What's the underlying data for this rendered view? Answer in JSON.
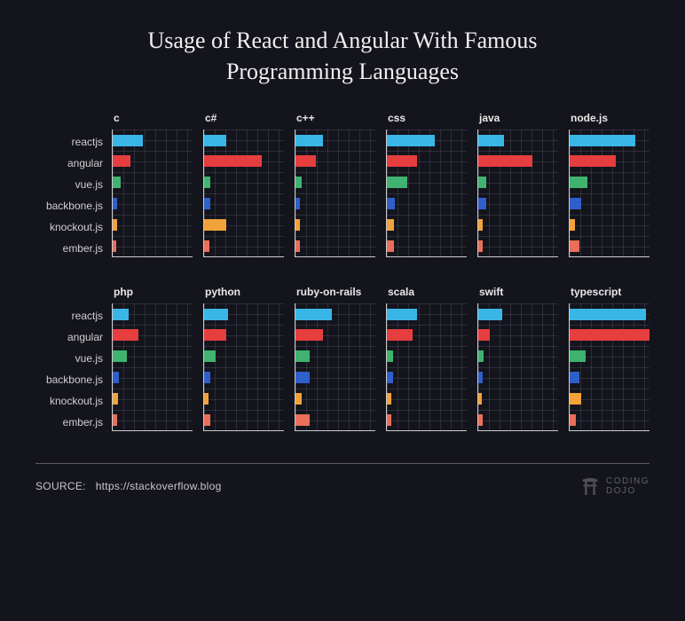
{
  "title_line1": "Usage of React and Angular With Famous",
  "title_line2": "Programming Languages",
  "source_label": "SOURCE:",
  "source_url": "https://stackoverflow.blog",
  "logo_line1": "CODING",
  "logo_line2": "DOJO",
  "frameworks": [
    "reactjs",
    "angular",
    "vue.js",
    "backbone.js",
    "knockout.js",
    "ember.js"
  ],
  "colors": {
    "reactjs": "#3ab6e6",
    "angular": "#e63e3e",
    "vue.js": "#3fb36f",
    "backbone.js": "#2f5fc9",
    "knockout.js": "#f2a23a",
    "ember.js": "#e96f5a"
  },
  "chart_data": {
    "type": "bar",
    "note": "Values are relative bar widths (0-100) estimated from pixel lengths; original axes unlabeled.",
    "series_labels": [
      "reactjs",
      "angular",
      "vue.js",
      "backbone.js",
      "knockout.js",
      "ember.js"
    ],
    "panels": [
      {
        "name": "c",
        "values": [
          38,
          22,
          10,
          6,
          5,
          4
        ]
      },
      {
        "name": "c#",
        "values": [
          28,
          72,
          8,
          8,
          28,
          7
        ]
      },
      {
        "name": "c++",
        "values": [
          34,
          26,
          8,
          6,
          5,
          6
        ]
      },
      {
        "name": "css",
        "values": [
          60,
          38,
          26,
          10,
          9,
          9
        ]
      },
      {
        "name": "java",
        "values": [
          32,
          68,
          10,
          10,
          6,
          5
        ]
      },
      {
        "name": "node.js",
        "values": [
          82,
          58,
          22,
          14,
          7,
          12
        ]
      },
      {
        "name": "php",
        "values": [
          20,
          32,
          18,
          8,
          7,
          6
        ]
      },
      {
        "name": "python",
        "values": [
          30,
          28,
          14,
          8,
          6,
          8
        ]
      },
      {
        "name": "ruby-on-rails",
        "values": [
          46,
          34,
          18,
          18,
          8,
          18
        ]
      },
      {
        "name": "scala",
        "values": [
          38,
          32,
          8,
          8,
          5,
          5
        ]
      },
      {
        "name": "swift",
        "values": [
          30,
          14,
          7,
          6,
          4,
          5
        ]
      },
      {
        "name": "typescript",
        "values": [
          95,
          100,
          20,
          12,
          14,
          8
        ]
      }
    ]
  }
}
